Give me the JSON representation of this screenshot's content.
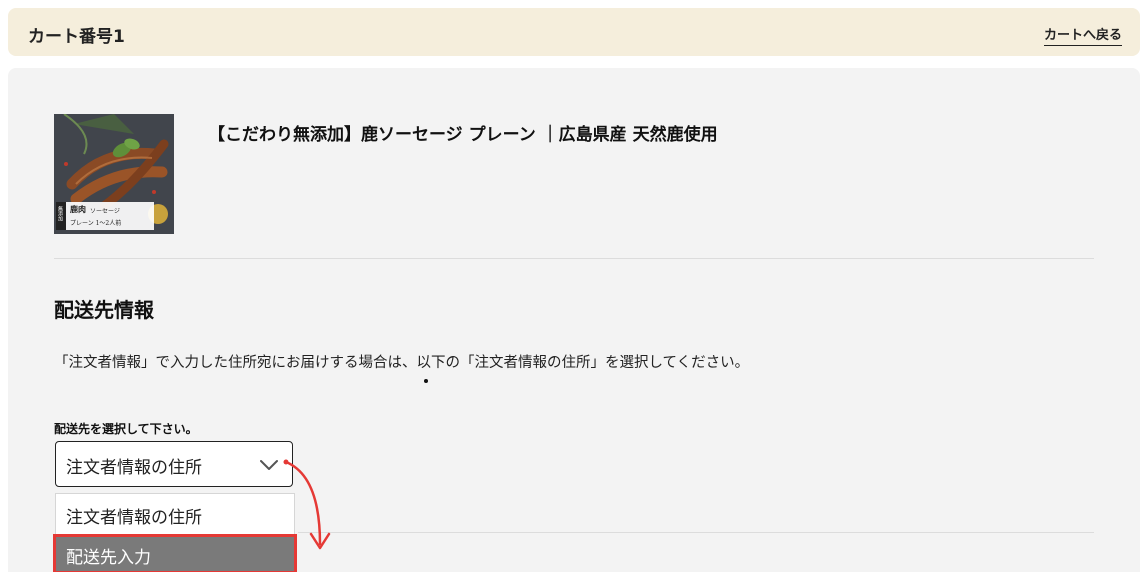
{
  "header": {
    "title": "カート番号1",
    "back_link": "カートへ戻る"
  },
  "product": {
    "name": "【こだわり無添加】鹿ソーセージ プレーン ｜広島県産 天然鹿使用",
    "image_label_main": "鹿肉",
    "image_label_sub": "ソーセージ",
    "image_label_line2": "プレーン 1〜2人前",
    "image_side_tag": "無添加"
  },
  "shipping": {
    "title": "配送先情報",
    "description": "「注文者情報」で入力した住所宛にお届けする場合は、以下の「注文者情報の住所」を選択してください。",
    "field_label": "配送先を選択して下さい。",
    "selected_value": "注文者情報の住所",
    "options": [
      {
        "label": "注文者情報の住所"
      },
      {
        "label": "配送先入力"
      }
    ]
  },
  "colors": {
    "header_bg": "#f5eedc",
    "panel_bg": "#f3f3f3",
    "highlight_border": "#e53935",
    "highlight_bg": "#7a7a7a"
  },
  "icons": {
    "select_arrow": "chevron-down-icon",
    "annotation": "curved-arrow-icon"
  }
}
